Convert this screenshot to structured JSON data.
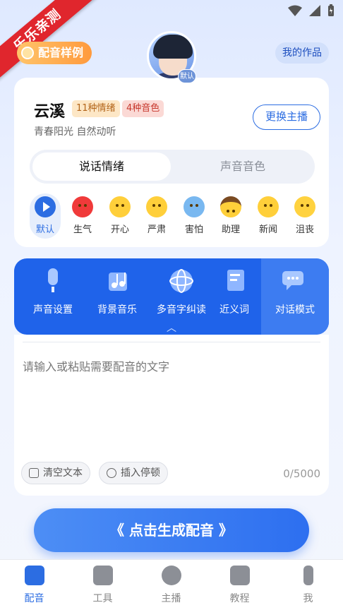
{
  "watermark": "乐乐亲测",
  "header": {
    "sample_button": "配音样例",
    "my_works_button": "我的作品"
  },
  "voice": {
    "name": "云溪",
    "tags": [
      "11种情绪",
      "4种音色"
    ],
    "description": "青春阳光 自然动听",
    "avatar_badge": "默认",
    "change_button": "更换主播"
  },
  "segmented": {
    "active": "说话情绪",
    "inactive": "声音音色"
  },
  "emotions": [
    {
      "label": "默认",
      "icon": "play-icon",
      "selected": true
    },
    {
      "label": "生气",
      "icon": "angry-face-icon"
    },
    {
      "label": "开心",
      "icon": "happy-face-icon"
    },
    {
      "label": "严肃",
      "icon": "serious-face-icon"
    },
    {
      "label": "害怕",
      "icon": "scared-face-icon"
    },
    {
      "label": "助理",
      "icon": "assistant-face-icon"
    },
    {
      "label": "新闻",
      "icon": "news-face-icon"
    },
    {
      "label": "沮丧",
      "icon": "sad-face-icon"
    }
  ],
  "toolbar": {
    "items": [
      {
        "label": "声音设置",
        "icon": "microphone-icon"
      },
      {
        "label": "背景音乐",
        "icon": "music-note-icon"
      },
      {
        "label": "多音字纠读",
        "icon": "globe-icon"
      },
      {
        "label": "近义词",
        "icon": "book-icon"
      },
      {
        "label": "对话模式",
        "icon": "chat-bubble-icon"
      }
    ],
    "accent": "#1f63ea"
  },
  "editor": {
    "placeholder": "请输入或粘贴需要配音的文字",
    "clear_button": "清空文本",
    "pause_button": "插入停顿",
    "counter": "0/5000"
  },
  "generate_button": "《 点击生成配音 》",
  "tabs": [
    {
      "label": "配音",
      "active": true
    },
    {
      "label": "工具"
    },
    {
      "label": "主播"
    },
    {
      "label": "教程"
    },
    {
      "label": "我"
    }
  ]
}
